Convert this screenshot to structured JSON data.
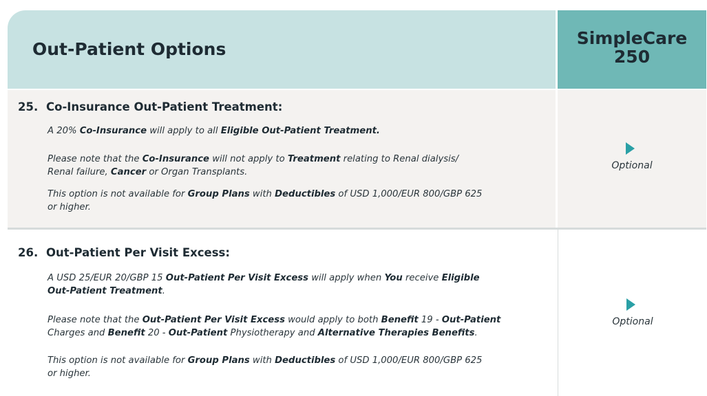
{
  "header": {
    "title": "Out-Patient Options",
    "plan_line1": "SimpleCare",
    "plan_line2": "250"
  },
  "rows": [
    {
      "number": "25.",
      "title": "Co-Insurance Out-Patient Treatment:",
      "paragraphs": [
        "A 20% Co-Insurance will apply to all Eligible Out-Patient Treatment.",
        "Please note that the Co-Insurance will not apply to Treatment relating to Renal dialysis/ Renal failure, Cancer or Organ Transplants.",
        "This option is not available for Group Plans with Deductibles of  USD 1,000/EUR 800/GBP 625 or higher."
      ],
      "option_label": "Optional",
      "option_icon": "play-triangle-icon"
    },
    {
      "number": "26.",
      "title": "Out-Patient Per Visit Excess:",
      "paragraphs": [
        "A USD 25/EUR 20/GBP 15 Out-Patient Per Visit Excess will apply when You receive Eligible Out-Patient Treatment.",
        "Please note that the Out-Patient Per Visit Excess would apply to both Benefit 19 - Out-Patient Charges and  Benefit 20 - Out-Patient Physiotherapy and Alternative Therapies Benefits.",
        "This option is not available for Group Plans with Deductibles of  USD 1,000/EUR 800/GBP 625 or higher."
      ],
      "option_label": "Optional",
      "option_icon": "play-triangle-icon"
    }
  ],
  "colors": {
    "header_left_bg": "#c7e2e2",
    "header_right_bg": "#6fb8b6",
    "row_shade": "#f4f2f0",
    "accent_triangle": "#2aa0a6"
  }
}
